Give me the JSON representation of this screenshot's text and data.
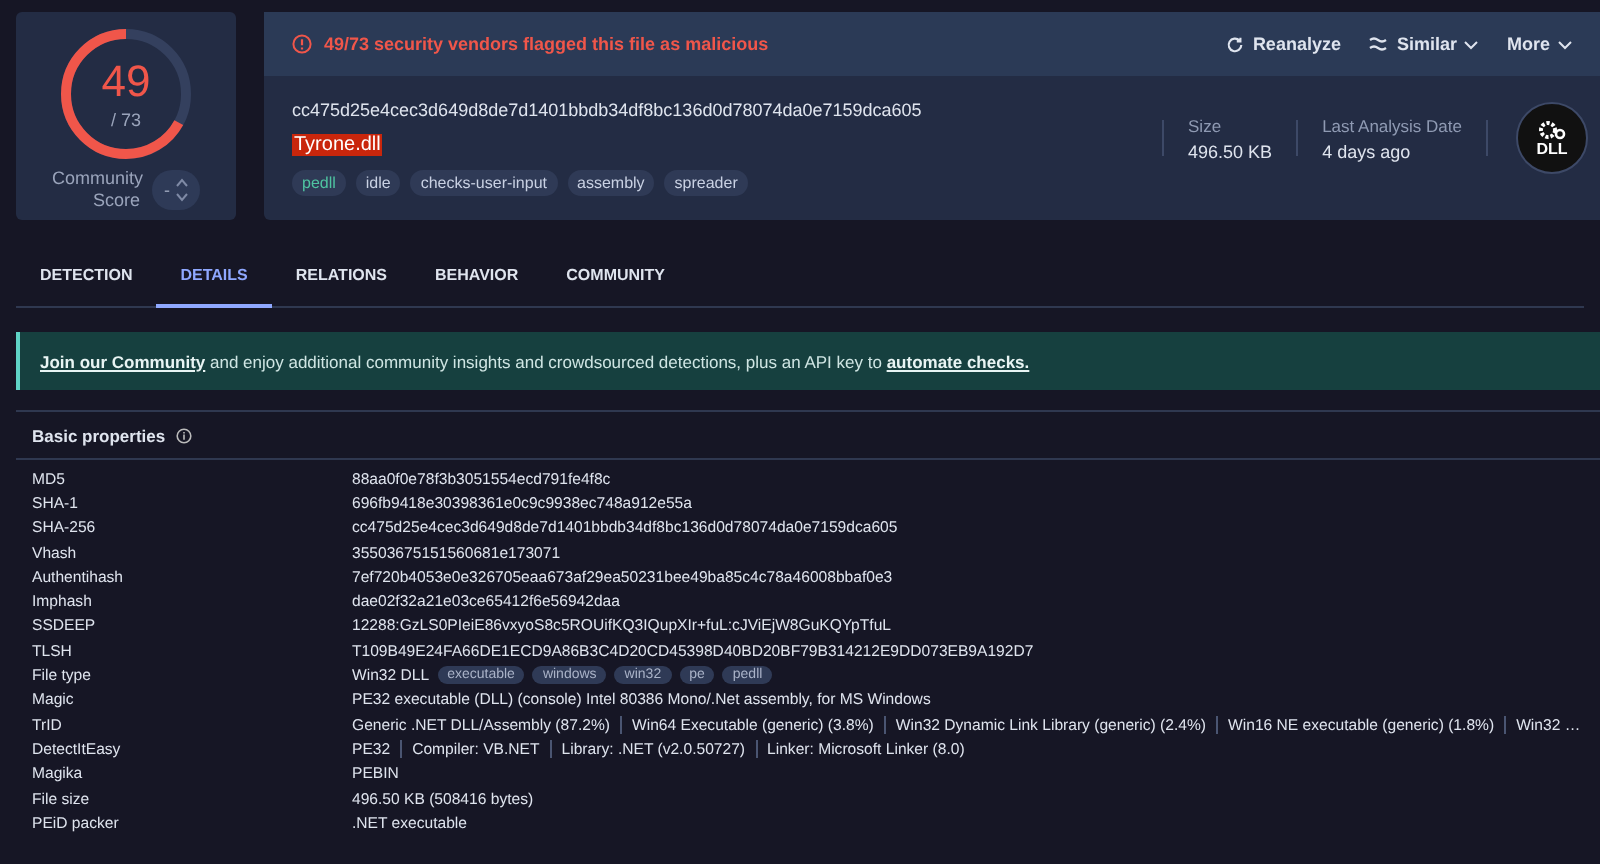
{
  "score": {
    "value": "49",
    "total": "/ 73",
    "label": "Community Score",
    "vote": "-"
  },
  "alert": {
    "text": "49/73 security vendors flagged this file as malicious"
  },
  "actions": [
    {
      "label": "Reanalyze",
      "kind": "reanalyze"
    },
    {
      "label": "Similar",
      "kind": "similar"
    },
    {
      "label": "More",
      "kind": "more"
    }
  ],
  "file": {
    "hash": "cc475d25e4cec3d649d8de7d1401bbdb34df8bc136d0d78074da0e7159dca605",
    "name": "Tyrone.dll",
    "highlighted": true,
    "tags": [
      {
        "label": "pedll",
        "color": "#4fc3a1"
      },
      {
        "label": "idle",
        "color": "#c9d1e3"
      },
      {
        "label": "checks-user-input",
        "color": "#c9d1e3"
      },
      {
        "label": "assembly",
        "color": "#c9d1e3"
      },
      {
        "label": "spreader",
        "color": "#c9d1e3"
      }
    ]
  },
  "meta": [
    {
      "label": "Size",
      "value": "496.50 KB"
    },
    {
      "label": "Last Analysis Date",
      "value": "4 days ago"
    }
  ],
  "file_type_badge": "DLL",
  "tabs": [
    {
      "label": "DETECTION",
      "selected": false
    },
    {
      "label": "DETAILS",
      "selected": true
    },
    {
      "label": "RELATIONS",
      "selected": false
    },
    {
      "label": "BEHAVIOR",
      "selected": false
    },
    {
      "label": "COMMUNITY",
      "selected": false
    }
  ],
  "banner": [
    {
      "text": "Join our Community",
      "link": true
    },
    {
      "text": " and enjoy additional community insights and crowdsourced detections, plus an API key to ",
      "link": false
    },
    {
      "text": "automate checks.",
      "link": true
    }
  ],
  "section": {
    "title": "Basic properties"
  },
  "properties": [
    {
      "label": "MD5",
      "kind": "text",
      "value": "88aa0f0e78f3b3051554ecd791fe4f8c"
    },
    {
      "label": "SHA-1",
      "kind": "text",
      "value": "696fb9418e30398361e0c9c9938ec748a912e55a"
    },
    {
      "label": "SHA-256",
      "kind": "text",
      "value": "cc475d25e4cec3d649d8de7d1401bbdb34df8bc136d0d78074da0e7159dca605"
    },
    {
      "label": "Vhash",
      "kind": "text",
      "value": "35503675151560681e173071"
    },
    {
      "label": "Authentihash",
      "kind": "text",
      "value": "7ef720b4053e0e326705eaa673af29ea50231bee49ba85c4c78a46008bbaf0e3"
    },
    {
      "label": "Imphash",
      "kind": "text",
      "value": "dae02f32a21e03ce65412f6e56942daa"
    },
    {
      "label": "SSDEEP",
      "kind": "text",
      "value": "12288:GzLS0PIeiE86vxyoS8c5ROUifKQ3IQupXIr+fuL:cJViEjW8GuKQYpTfuL"
    },
    {
      "label": "TLSH",
      "kind": "text",
      "value": "T109B49E24FA66DE1ECD9A86B3C4D20CD45398D40BD20BF79B314212E9DD073EB9A192D7"
    },
    {
      "label": "File type",
      "kind": "tags",
      "value": "Win32 DLL",
      "tags": [
        "executable",
        "windows",
        "win32",
        "pe",
        "pedll"
      ]
    },
    {
      "label": "Magic",
      "kind": "text",
      "value": "PE32 executable (DLL) (console) Intel 80386 Mono/.Net assembly, for MS Windows"
    },
    {
      "label": "TrID",
      "kind": "segments",
      "segments": [
        "Generic .NET DLL/Assembly (87.2%)",
        "Win64 Executable (generic) (3.8%)",
        "Win32 Dynamic Link Library (generic) (2.4%)",
        "Win16 NE executable (generic) (1.8%)",
        "Win32 …"
      ]
    },
    {
      "label": "DetectItEasy",
      "kind": "segments",
      "segments": [
        "PE32",
        "Compiler: VB.NET",
        "Library: .NET (v2.0.50727)",
        "Linker: Microsoft Linker (8.0)"
      ]
    },
    {
      "label": "Magika",
      "kind": "text",
      "value": "PEBIN"
    },
    {
      "label": "File size",
      "kind": "text",
      "value": "496.50 KB (508416 bytes)"
    },
    {
      "label": "PEiD packer",
      "kind": "text",
      "value": ".NET executable"
    }
  ]
}
